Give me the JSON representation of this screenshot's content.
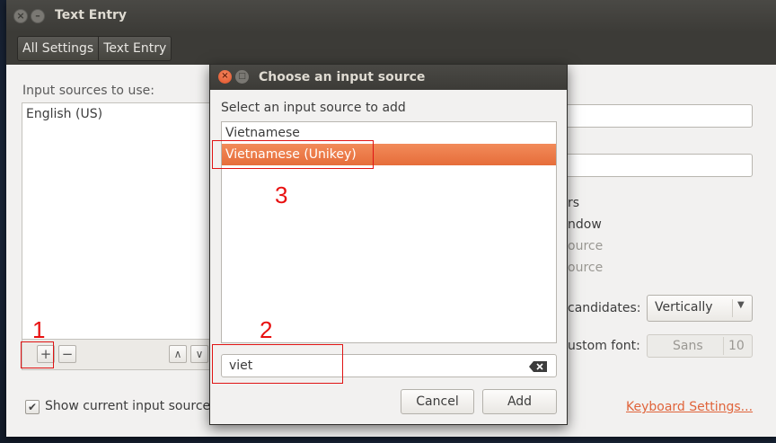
{
  "window": {
    "title": "Text Entry",
    "breadcrumbs": [
      "All Settings",
      "Text Entry"
    ]
  },
  "left_panel": {
    "label": "Input sources to use:",
    "items": [
      "English (US)"
    ],
    "add_label": "+",
    "remove_label": "−",
    "move_up_label": "∧",
    "move_down_label": "∨"
  },
  "show_current": {
    "checked": true,
    "label": "Show current input source in the menu bar"
  },
  "right_panel": {
    "partial_texts": [
      "rs",
      "ndow",
      "ource",
      "ource"
    ],
    "candidates_label": "candidates:",
    "candidates_value": "Vertically",
    "custom_font_label": "ustom font:",
    "font_name": "Sans",
    "font_size": "10",
    "keyboard_settings_link": "Keyboard Settings..."
  },
  "dialog": {
    "title": "Choose an input source",
    "label": "Select an input source to add",
    "items": [
      {
        "label": "Vietnamese",
        "selected": false
      },
      {
        "label": "Vietnamese (Unikey)",
        "selected": true
      }
    ],
    "search_value": "viet",
    "cancel_label": "Cancel",
    "add_label": "Add"
  },
  "annotations": [
    "1",
    "2",
    "3"
  ],
  "colors": {
    "selection": "#e96f3d",
    "annotation": "#e01414",
    "link": "#e0643b"
  }
}
